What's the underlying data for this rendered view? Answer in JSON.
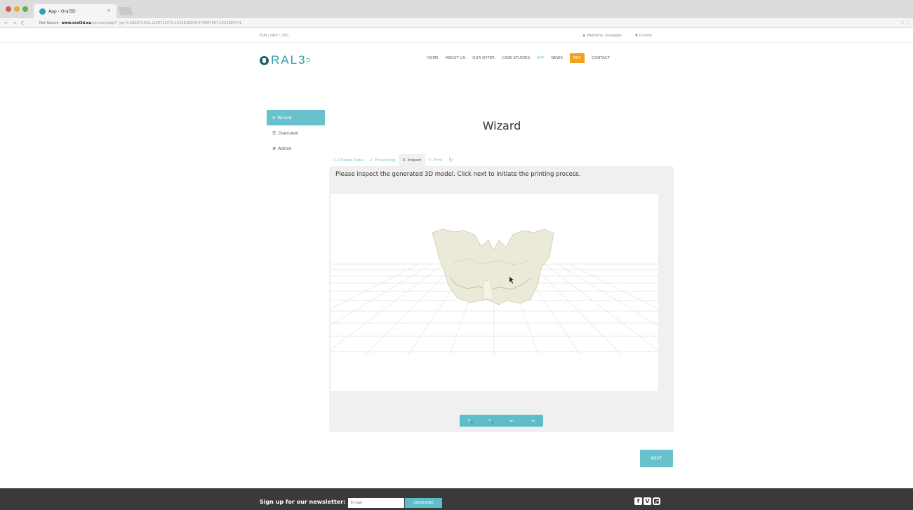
{
  "browser": {
    "tab_title": "App - Oral3D",
    "tab_close": "×",
    "not_secure": "Not Secure",
    "url_host": "www.oral3d.eu",
    "url_path": "/services/app/?_ga=2.182971302.1228725579.1531818256-570007067.1521883741",
    "star": "☆",
    "menu": "⋮",
    "back": "←",
    "forward": "→",
    "reload": "C"
  },
  "utilbar": {
    "currency": "EUR / GBP / USD",
    "welcome": "Welcome, Giuseppe",
    "cart": "0 items"
  },
  "header": {
    "logo_text": "RAL3",
    "logo_sup": "D",
    "nav": [
      "HOME",
      "ABOUT US",
      "OUR OFFER",
      "CASE STUDIES",
      "APP",
      "NEWS",
      "BUY",
      "CONTACT"
    ]
  },
  "sidebar": {
    "items": [
      {
        "label": "Wizard",
        "icon": "A"
      },
      {
        "label": "Overview",
        "icon": "☰"
      },
      {
        "label": "Admin",
        "icon": "⚙"
      }
    ]
  },
  "wizard": {
    "title": "Wizard",
    "steps": [
      "1. Choose Data",
      "2. Processing",
      "3. Inspect",
      "4. Print"
    ],
    "refresh": "↻",
    "instruction": "Please inspect the generated 3D model. Click next to initiate the printing process.",
    "controls": [
      "🔍",
      "🔍",
      "←",
      "→"
    ],
    "next": "NEXT"
  },
  "footer": {
    "newsletter_label": "Sign up for our newsletter:",
    "email_placeholder": "E-mail",
    "subscribe": "SUBSCRIBE",
    "facebook": "f",
    "vimeo": "V"
  },
  "colors": {
    "accent": "#68c2cd",
    "buy": "#f6a019",
    "footer": "#3a3a3a"
  }
}
